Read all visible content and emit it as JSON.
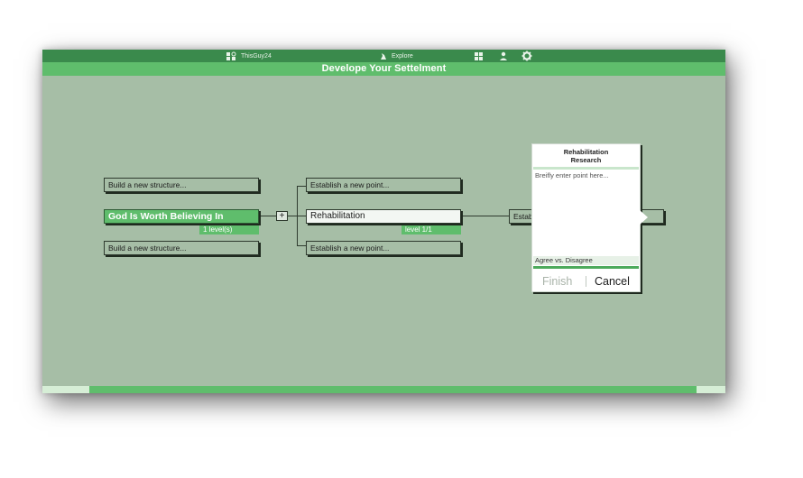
{
  "header": {
    "username": "ThisGuy24",
    "explore_label": "Explore",
    "title": "Develope Your Settelment",
    "icons": [
      "profile-icon",
      "explore-icon",
      "grid-icon",
      "user-icon",
      "gear-icon"
    ]
  },
  "left_column": {
    "top_placeholder": "Build a new structure...",
    "main_label": "God Is Worth Believing In",
    "main_sub": "1 level(s)",
    "bottom_placeholder": "Build a new structure..."
  },
  "middle_column": {
    "top_placeholder": "Establish a new point...",
    "main_label": "Rehabilitation",
    "main_sub": "level 1/1",
    "bottom_placeholder": "Establish a new point..."
  },
  "right_node": {
    "partial_label": "Estab"
  },
  "expand_button": "+",
  "panel": {
    "title_line1": "Rehabilitation",
    "title_line2": "Research",
    "input_placeholder": "Breifly enter point here...",
    "agree_label": "Agree vs. Disagree",
    "finish_label": "Finish",
    "cancel_label": "Cancel"
  },
  "colors": {
    "background": "#a6bea6",
    "topbar": "#3a8a4c",
    "accent": "#5fbd6c"
  }
}
